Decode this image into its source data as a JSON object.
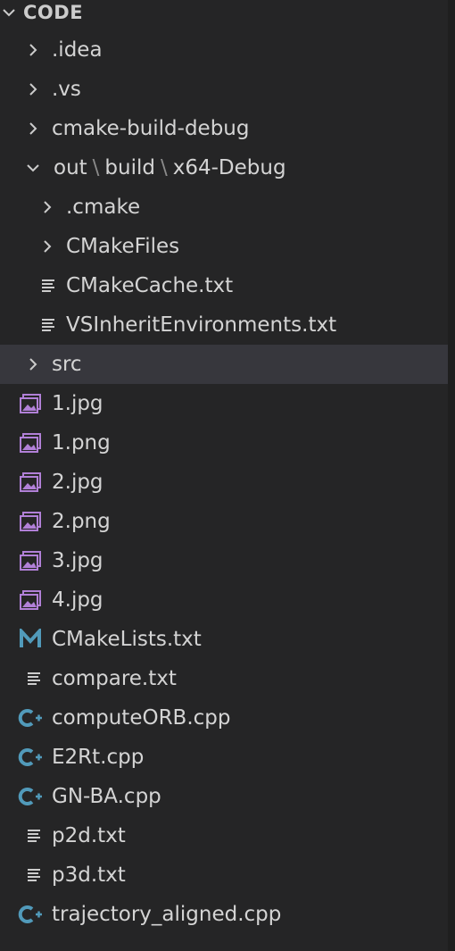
{
  "header": {
    "title": "CODE"
  },
  "tree": {
    "idea": ".idea",
    "vs": ".vs",
    "cmake_build_debug": "cmake-build-debug",
    "out_path": {
      "out": "out",
      "sep": "\\",
      "build": "build",
      "sep2": "\\",
      "x64": "x64-Debug"
    },
    "cmake": ".cmake",
    "cmakefiles": "CMakeFiles",
    "cmakecache": "CMakeCache.txt",
    "vsinherit": "VSInheritEnvironments.txt",
    "src": "src",
    "files": {
      "img1jpg": "1.jpg",
      "img1png": "1.png",
      "img2jpg": "2.jpg",
      "img2png": "2.png",
      "img3jpg": "3.jpg",
      "img4jpg": "4.jpg",
      "cmakelists": "CMakeLists.txt",
      "compare": "compare.txt",
      "computeorb": "computeORB.cpp",
      "e2rt": "E2Rt.cpp",
      "gnba": "GN-BA.cpp",
      "p2d": "p2d.txt",
      "p3d": "p3d.txt",
      "trajectory": "trajectory_aligned.cpp"
    }
  },
  "colors": {
    "image_icon": "#b180d7",
    "cmake_icon": "#519aba",
    "cpp_icon": "#519aba",
    "text_icon": "#cccccc"
  }
}
